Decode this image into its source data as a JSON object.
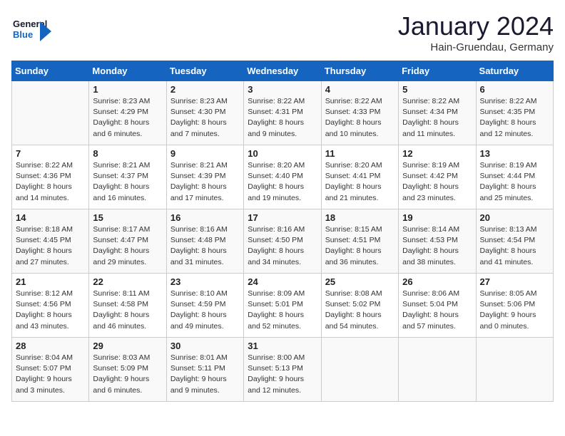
{
  "header": {
    "logo_line1": "General",
    "logo_line2": "Blue",
    "month_title": "January 2024",
    "location": "Hain-Gruendau, Germany"
  },
  "weekdays": [
    "Sunday",
    "Monday",
    "Tuesday",
    "Wednesday",
    "Thursday",
    "Friday",
    "Saturday"
  ],
  "weeks": [
    [
      {
        "day": "",
        "detail": ""
      },
      {
        "day": "1",
        "detail": "Sunrise: 8:23 AM\nSunset: 4:29 PM\nDaylight: 8 hours\nand 6 minutes."
      },
      {
        "day": "2",
        "detail": "Sunrise: 8:23 AM\nSunset: 4:30 PM\nDaylight: 8 hours\nand 7 minutes."
      },
      {
        "day": "3",
        "detail": "Sunrise: 8:22 AM\nSunset: 4:31 PM\nDaylight: 8 hours\nand 9 minutes."
      },
      {
        "day": "4",
        "detail": "Sunrise: 8:22 AM\nSunset: 4:33 PM\nDaylight: 8 hours\nand 10 minutes."
      },
      {
        "day": "5",
        "detail": "Sunrise: 8:22 AM\nSunset: 4:34 PM\nDaylight: 8 hours\nand 11 minutes."
      },
      {
        "day": "6",
        "detail": "Sunrise: 8:22 AM\nSunset: 4:35 PM\nDaylight: 8 hours\nand 12 minutes."
      }
    ],
    [
      {
        "day": "7",
        "detail": "Sunrise: 8:22 AM\nSunset: 4:36 PM\nDaylight: 8 hours\nand 14 minutes."
      },
      {
        "day": "8",
        "detail": "Sunrise: 8:21 AM\nSunset: 4:37 PM\nDaylight: 8 hours\nand 16 minutes."
      },
      {
        "day": "9",
        "detail": "Sunrise: 8:21 AM\nSunset: 4:39 PM\nDaylight: 8 hours\nand 17 minutes."
      },
      {
        "day": "10",
        "detail": "Sunrise: 8:20 AM\nSunset: 4:40 PM\nDaylight: 8 hours\nand 19 minutes."
      },
      {
        "day": "11",
        "detail": "Sunrise: 8:20 AM\nSunset: 4:41 PM\nDaylight: 8 hours\nand 21 minutes."
      },
      {
        "day": "12",
        "detail": "Sunrise: 8:19 AM\nSunset: 4:42 PM\nDaylight: 8 hours\nand 23 minutes."
      },
      {
        "day": "13",
        "detail": "Sunrise: 8:19 AM\nSunset: 4:44 PM\nDaylight: 8 hours\nand 25 minutes."
      }
    ],
    [
      {
        "day": "14",
        "detail": "Sunrise: 8:18 AM\nSunset: 4:45 PM\nDaylight: 8 hours\nand 27 minutes."
      },
      {
        "day": "15",
        "detail": "Sunrise: 8:17 AM\nSunset: 4:47 PM\nDaylight: 8 hours\nand 29 minutes."
      },
      {
        "day": "16",
        "detail": "Sunrise: 8:16 AM\nSunset: 4:48 PM\nDaylight: 8 hours\nand 31 minutes."
      },
      {
        "day": "17",
        "detail": "Sunrise: 8:16 AM\nSunset: 4:50 PM\nDaylight: 8 hours\nand 34 minutes."
      },
      {
        "day": "18",
        "detail": "Sunrise: 8:15 AM\nSunset: 4:51 PM\nDaylight: 8 hours\nand 36 minutes."
      },
      {
        "day": "19",
        "detail": "Sunrise: 8:14 AM\nSunset: 4:53 PM\nDaylight: 8 hours\nand 38 minutes."
      },
      {
        "day": "20",
        "detail": "Sunrise: 8:13 AM\nSunset: 4:54 PM\nDaylight: 8 hours\nand 41 minutes."
      }
    ],
    [
      {
        "day": "21",
        "detail": "Sunrise: 8:12 AM\nSunset: 4:56 PM\nDaylight: 8 hours\nand 43 minutes."
      },
      {
        "day": "22",
        "detail": "Sunrise: 8:11 AM\nSunset: 4:58 PM\nDaylight: 8 hours\nand 46 minutes."
      },
      {
        "day": "23",
        "detail": "Sunrise: 8:10 AM\nSunset: 4:59 PM\nDaylight: 8 hours\nand 49 minutes."
      },
      {
        "day": "24",
        "detail": "Sunrise: 8:09 AM\nSunset: 5:01 PM\nDaylight: 8 hours\nand 52 minutes."
      },
      {
        "day": "25",
        "detail": "Sunrise: 8:08 AM\nSunset: 5:02 PM\nDaylight: 8 hours\nand 54 minutes."
      },
      {
        "day": "26",
        "detail": "Sunrise: 8:06 AM\nSunset: 5:04 PM\nDaylight: 8 hours\nand 57 minutes."
      },
      {
        "day": "27",
        "detail": "Sunrise: 8:05 AM\nSunset: 5:06 PM\nDaylight: 9 hours\nand 0 minutes."
      }
    ],
    [
      {
        "day": "28",
        "detail": "Sunrise: 8:04 AM\nSunset: 5:07 PM\nDaylight: 9 hours\nand 3 minutes."
      },
      {
        "day": "29",
        "detail": "Sunrise: 8:03 AM\nSunset: 5:09 PM\nDaylight: 9 hours\nand 6 minutes."
      },
      {
        "day": "30",
        "detail": "Sunrise: 8:01 AM\nSunset: 5:11 PM\nDaylight: 9 hours\nand 9 minutes."
      },
      {
        "day": "31",
        "detail": "Sunrise: 8:00 AM\nSunset: 5:13 PM\nDaylight: 9 hours\nand 12 minutes."
      },
      {
        "day": "",
        "detail": ""
      },
      {
        "day": "",
        "detail": ""
      },
      {
        "day": "",
        "detail": ""
      }
    ]
  ]
}
